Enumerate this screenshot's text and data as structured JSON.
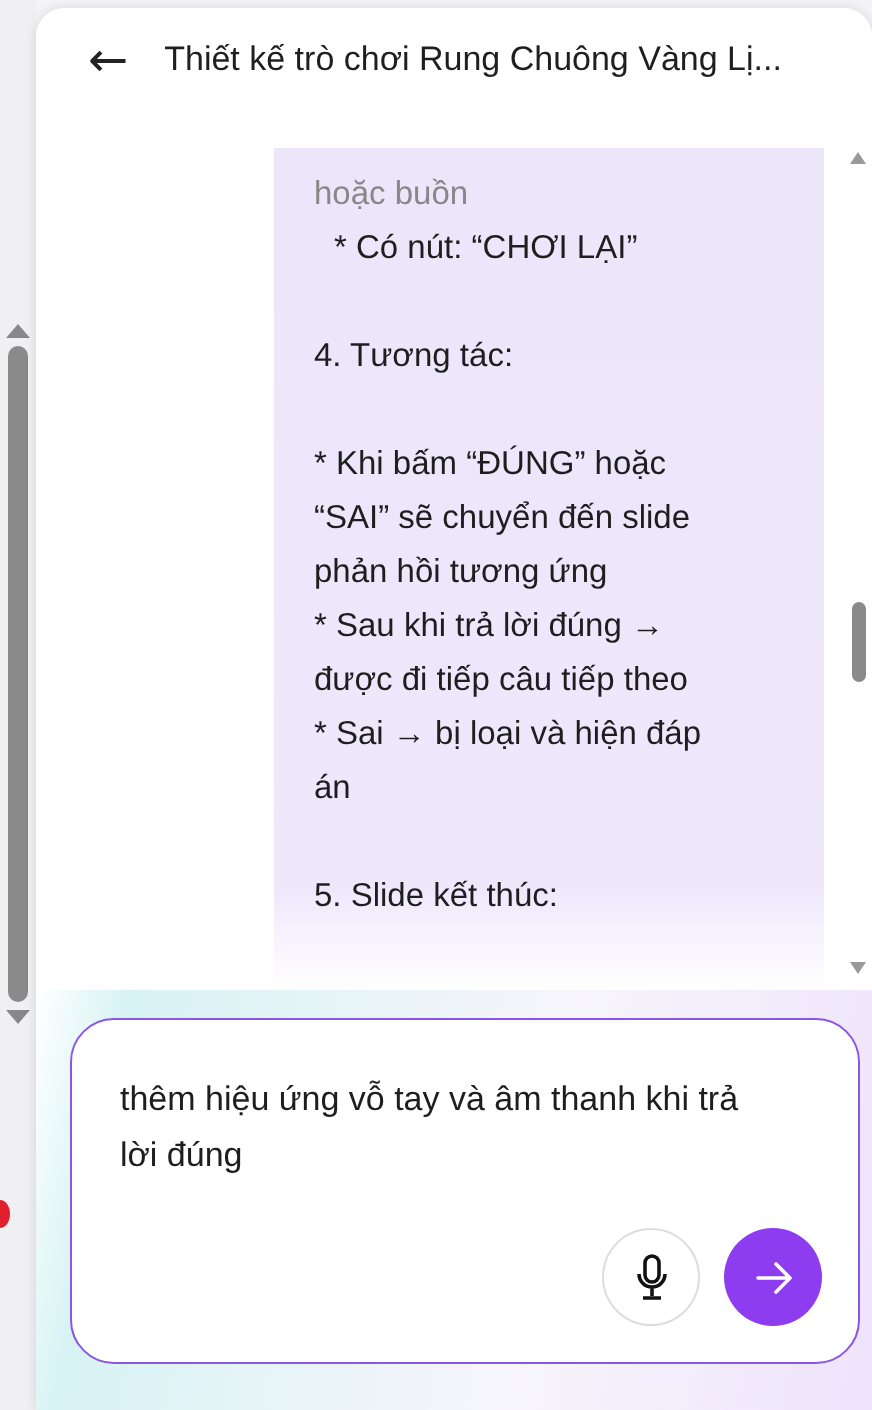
{
  "header": {
    "back": "←",
    "title": "Thiết kế trò chơi Rung Chuông Vàng Lị..."
  },
  "message": {
    "paragraphs": [
      {
        "text": "hoặc buồn",
        "kind": "faded"
      },
      {
        "text": "* Có nút: “CHƠI LẠI”",
        "kind": "indented"
      },
      {
        "kind": "blank"
      },
      {
        "text": "4. Tương tác:",
        "kind": "line"
      },
      {
        "kind": "blank"
      },
      {
        "text": "* Khi bấm “ĐÚNG” hoặc “SAI” sẽ chuyển đến slide phản hồi tương ứng",
        "kind": "line"
      },
      {
        "text": "* Sau khi trả lời đúng → được đi tiếp câu tiếp theo",
        "kind": "line"
      },
      {
        "text": "* Sai → bị loại và hiện đáp án",
        "kind": "line"
      },
      {
        "kind": "blank"
      },
      {
        "text": "5. Slide kết thúc:",
        "kind": "line"
      }
    ]
  },
  "composer": {
    "value": "thêm hiệu ứng vỗ tay và âm thanh khi trả lời đúng"
  }
}
